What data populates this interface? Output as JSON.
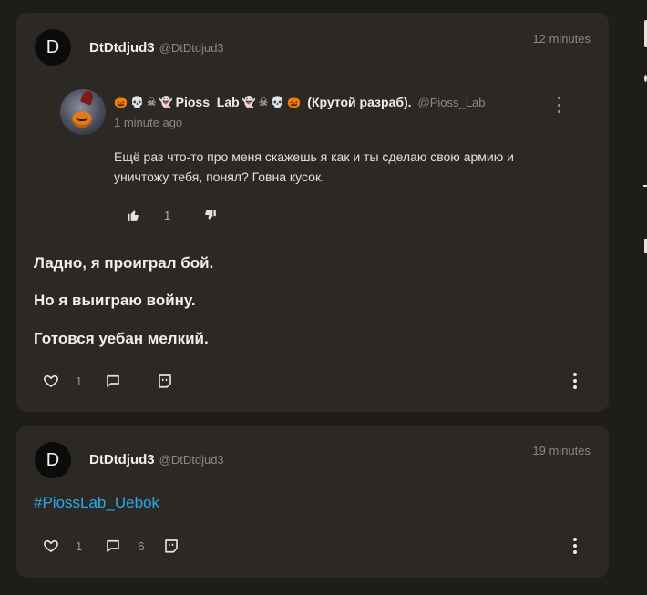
{
  "posts": [
    {
      "author": {
        "initial": "D",
        "name": "DtDtdjud3",
        "handle": "@DtDtdjud3"
      },
      "time": "12 minutes",
      "quote": {
        "prefix_emojis": [
          "🎃",
          "💀",
          "☠",
          "👻"
        ],
        "name": "Pioss_Lab",
        "suffix_emojis": [
          "👻",
          "☠",
          "💀",
          "🎃"
        ],
        "suffix_text": "(Крутой разраб).",
        "handle": "@Pioss_Lab",
        "time": "1 minute ago",
        "text": "Ещё раз что-то про меня скажешь я как и ты сделаю свою армию и уничтожу тебя, понял? Говна кусок.",
        "likes": "1"
      },
      "lines": [
        "Ладно, я проиграл бой.",
        "Но я выиграю войну.",
        "Готовся уебан мелкий."
      ],
      "likes": "1",
      "comments": ""
    },
    {
      "author": {
        "initial": "D",
        "name": "DtDtdjud3",
        "handle": "@DtDtdjud3"
      },
      "time": "19 minutes",
      "hashtag": "#PiossLab_Uebok",
      "likes": "1",
      "comments": "6"
    }
  ],
  "colors": {
    "background": "#1f1d1a",
    "card": "#2c2925",
    "hashtag": "#2aa7ee",
    "muted": "#8c8780"
  }
}
